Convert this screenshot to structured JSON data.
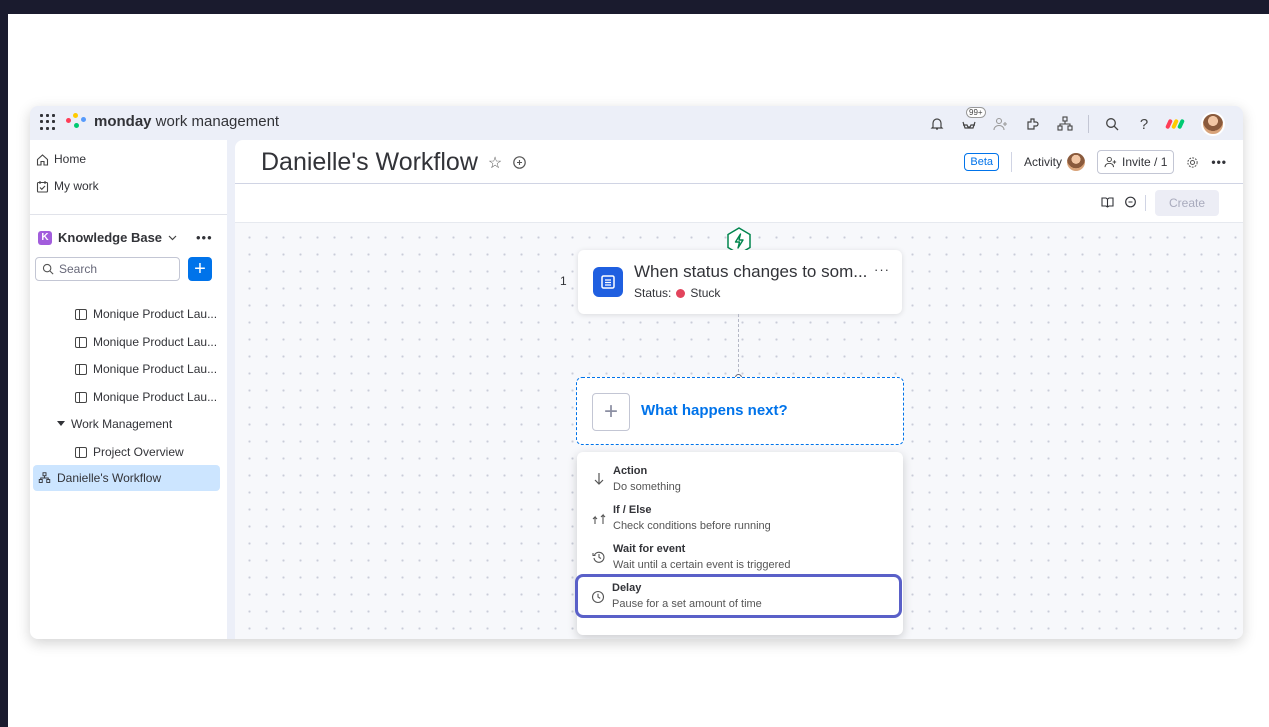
{
  "brand": {
    "name_bold": "monday",
    "name_rest": " work management"
  },
  "topbar": {
    "notifications_badge": "99+"
  },
  "sidebar": {
    "home": "Home",
    "my_work": "My work",
    "workspace_letter": "K",
    "workspace_name": "Knowledge Base",
    "search_placeholder": "Search",
    "items": [
      {
        "label": "Monique Product Lau..."
      },
      {
        "label": "Monique Product Lau..."
      },
      {
        "label": "Monique Product Lau..."
      },
      {
        "label": "Monique Product Lau..."
      }
    ],
    "folder": "Work Management",
    "folder_item": "Project Overview",
    "active_item": "Danielle's Workflow"
  },
  "header": {
    "title": "Danielle's Workflow",
    "beta": "Beta",
    "activity": "Activity",
    "invite": "Invite / 1",
    "create": "Create"
  },
  "trigger": {
    "step_number": "1",
    "title": "When status changes to som...",
    "status_label": "Status:",
    "status_value": "Stuck",
    "status_color": "#e2445c"
  },
  "next": {
    "label": "What happens next?"
  },
  "menu": [
    {
      "title": "Action",
      "desc": "Do something",
      "icon": "arrow-down-icon"
    },
    {
      "title": "If / Else",
      "desc": "Check conditions before running",
      "icon": "branch-icon"
    },
    {
      "title": "Wait for event",
      "desc": "Wait until a certain event is triggered",
      "icon": "history-icon"
    },
    {
      "title": "Delay",
      "desc": "Pause for a set amount of time",
      "icon": "clock-icon"
    }
  ],
  "colors": {
    "accent": "#0073ea",
    "highlight": "#5a60c8",
    "page_bg": "#1a1b2e"
  }
}
